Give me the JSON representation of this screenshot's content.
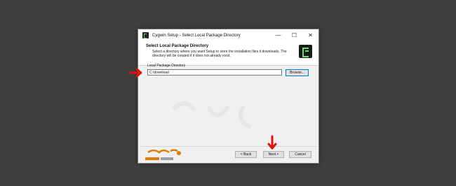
{
  "window": {
    "title": "Cygwin Setup - Select Local Package Directory",
    "controls": {
      "minimize": "—",
      "maximize": "☐",
      "close": "✕"
    }
  },
  "header": {
    "title": "Select Local Package Directory",
    "description": "Select a directory where you want Setup to store the installation files it downloads.  The directory will be created if it does not already exist."
  },
  "main": {
    "dir_label": "Local Package Directory",
    "dir_value": "C:\\download",
    "browse_label": "Browse..."
  },
  "footer": {
    "back_label": "< Back",
    "next_label": "Next >",
    "cancel_label": "Cancel"
  },
  "colors": {
    "arrow": "#e01010",
    "accent": "#0078d7"
  }
}
